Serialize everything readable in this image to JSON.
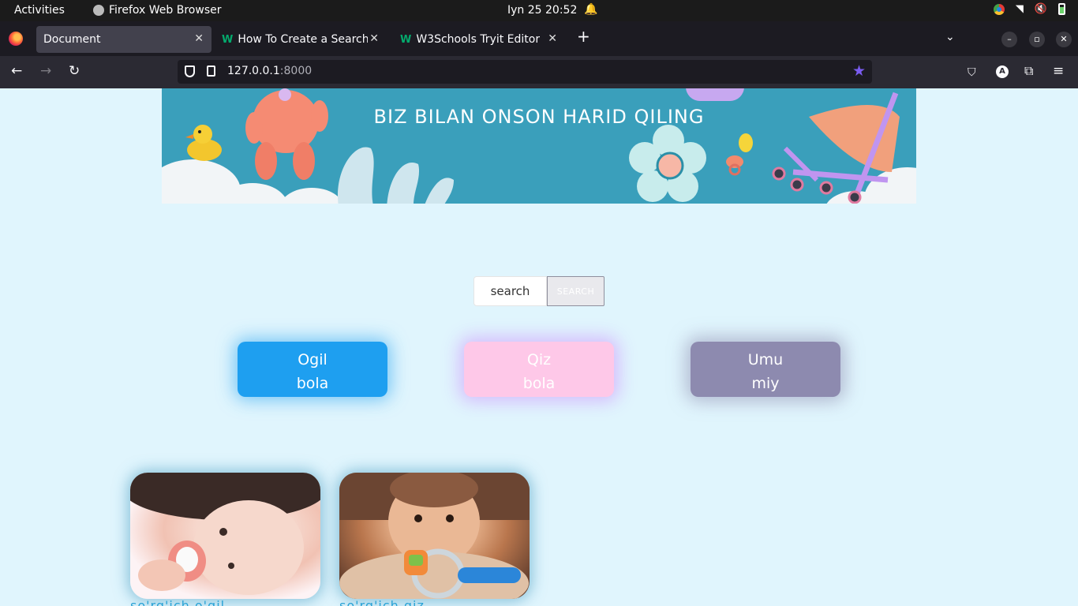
{
  "system_bar": {
    "activities": "Activities",
    "app_name": "Firefox Web Browser",
    "clock": "Iyn 25  20:52"
  },
  "browser": {
    "tabs": [
      {
        "label": "Document",
        "active": true
      },
      {
        "label": "How To Create a Search B",
        "active": false
      },
      {
        "label": "W3Schools Tryit Editor",
        "active": false
      }
    ],
    "url_host": "127.0.0.1",
    "url_port": ":8000",
    "account_initial": "A"
  },
  "page": {
    "hero_title": "BIZ BILAN ONSON HARID QILING",
    "search": {
      "placeholder": "search",
      "button_label": "SEARCH"
    },
    "categories": [
      {
        "line1": "Ogil",
        "line2": "bola",
        "color": "#1e9ff0"
      },
      {
        "line1": "Qiz",
        "line2": "bola",
        "color": "#fec8e8"
      },
      {
        "line1": "Umu",
        "line2": "miy",
        "color": "#8d8aaf"
      }
    ],
    "products": [
      {
        "label": "so'rg'ich o'gil"
      },
      {
        "label": "so'rg'ich qiz"
      }
    ]
  }
}
